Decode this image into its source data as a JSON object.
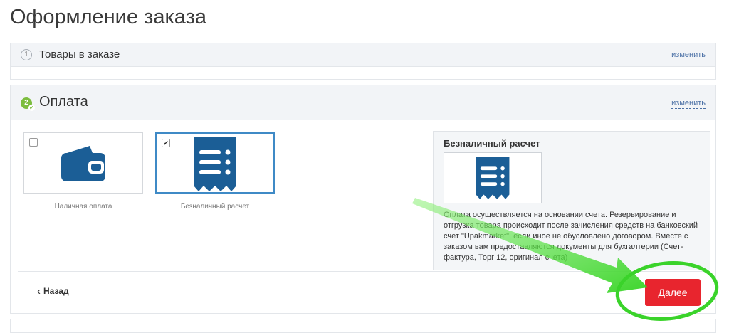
{
  "page": {
    "title": "Оформление заказа"
  },
  "step1": {
    "number": "1",
    "title": "Товары в заказе",
    "change_label": "изменить"
  },
  "step2": {
    "number": "2",
    "title": "Оплата",
    "change_label": "изменить",
    "options": [
      {
        "label": "Наличная оплата",
        "checked": false,
        "icon": "wallet-icon"
      },
      {
        "label": "Безналичный расчет",
        "checked": true,
        "icon": "receipt-icon"
      }
    ],
    "info": {
      "title": "Безналичный расчет",
      "icon": "receipt-icon",
      "text": "Оплата осуществляется на основании счета. Резервирование и отгрузка товара происходит после зачисления средств на банковский счет \"Upakmarket\", если иное не обусловлено договором. Вместе с заказом вам предоставляются документы для бухгалтерии (Счет-фактура, Торг 12, оригинал счета)"
    },
    "check_mark": "✔"
  },
  "navigation": {
    "back_label": "Назад",
    "next_label": "Далее"
  },
  "colors": {
    "accent_blue": "#1b5e96",
    "next_button": "#e8252e",
    "step_done": "#7cbd3f",
    "annotation_green": "#3ad32a",
    "link": "#4a6fa5"
  }
}
